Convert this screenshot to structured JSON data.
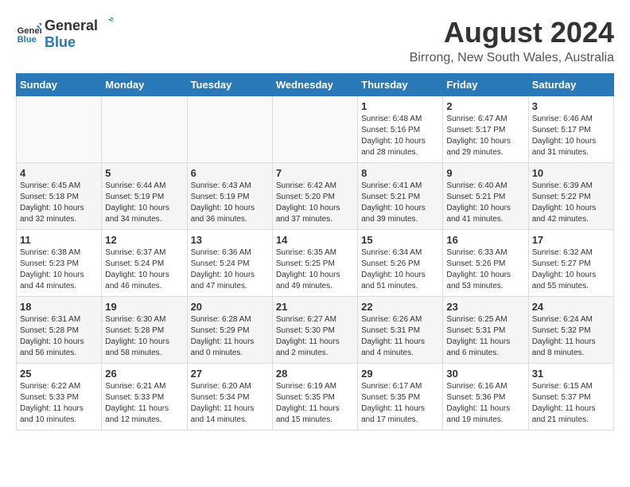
{
  "logo": {
    "line1": "General",
    "line2": "Blue"
  },
  "title": "August 2024",
  "location": "Birrong, New South Wales, Australia",
  "days_of_week": [
    "Sunday",
    "Monday",
    "Tuesday",
    "Wednesday",
    "Thursday",
    "Friday",
    "Saturday"
  ],
  "weeks": [
    [
      {
        "day": "",
        "info": ""
      },
      {
        "day": "",
        "info": ""
      },
      {
        "day": "",
        "info": ""
      },
      {
        "day": "",
        "info": ""
      },
      {
        "day": "1",
        "info": "Sunrise: 6:48 AM\nSunset: 5:16 PM\nDaylight: 10 hours\nand 28 minutes."
      },
      {
        "day": "2",
        "info": "Sunrise: 6:47 AM\nSunset: 5:17 PM\nDaylight: 10 hours\nand 29 minutes."
      },
      {
        "day": "3",
        "info": "Sunrise: 6:46 AM\nSunset: 5:17 PM\nDaylight: 10 hours\nand 31 minutes."
      }
    ],
    [
      {
        "day": "4",
        "info": "Sunrise: 6:45 AM\nSunset: 5:18 PM\nDaylight: 10 hours\nand 32 minutes."
      },
      {
        "day": "5",
        "info": "Sunrise: 6:44 AM\nSunset: 5:19 PM\nDaylight: 10 hours\nand 34 minutes."
      },
      {
        "day": "6",
        "info": "Sunrise: 6:43 AM\nSunset: 5:19 PM\nDaylight: 10 hours\nand 36 minutes."
      },
      {
        "day": "7",
        "info": "Sunrise: 6:42 AM\nSunset: 5:20 PM\nDaylight: 10 hours\nand 37 minutes."
      },
      {
        "day": "8",
        "info": "Sunrise: 6:41 AM\nSunset: 5:21 PM\nDaylight: 10 hours\nand 39 minutes."
      },
      {
        "day": "9",
        "info": "Sunrise: 6:40 AM\nSunset: 5:21 PM\nDaylight: 10 hours\nand 41 minutes."
      },
      {
        "day": "10",
        "info": "Sunrise: 6:39 AM\nSunset: 5:22 PM\nDaylight: 10 hours\nand 42 minutes."
      }
    ],
    [
      {
        "day": "11",
        "info": "Sunrise: 6:38 AM\nSunset: 5:23 PM\nDaylight: 10 hours\nand 44 minutes."
      },
      {
        "day": "12",
        "info": "Sunrise: 6:37 AM\nSunset: 5:24 PM\nDaylight: 10 hours\nand 46 minutes."
      },
      {
        "day": "13",
        "info": "Sunrise: 6:36 AM\nSunset: 5:24 PM\nDaylight: 10 hours\nand 47 minutes."
      },
      {
        "day": "14",
        "info": "Sunrise: 6:35 AM\nSunset: 5:25 PM\nDaylight: 10 hours\nand 49 minutes."
      },
      {
        "day": "15",
        "info": "Sunrise: 6:34 AM\nSunset: 5:26 PM\nDaylight: 10 hours\nand 51 minutes."
      },
      {
        "day": "16",
        "info": "Sunrise: 6:33 AM\nSunset: 5:26 PM\nDaylight: 10 hours\nand 53 minutes."
      },
      {
        "day": "17",
        "info": "Sunrise: 6:32 AM\nSunset: 5:27 PM\nDaylight: 10 hours\nand 55 minutes."
      }
    ],
    [
      {
        "day": "18",
        "info": "Sunrise: 6:31 AM\nSunset: 5:28 PM\nDaylight: 10 hours\nand 56 minutes."
      },
      {
        "day": "19",
        "info": "Sunrise: 6:30 AM\nSunset: 5:28 PM\nDaylight: 10 hours\nand 58 minutes."
      },
      {
        "day": "20",
        "info": "Sunrise: 6:28 AM\nSunset: 5:29 PM\nDaylight: 11 hours\nand 0 minutes."
      },
      {
        "day": "21",
        "info": "Sunrise: 6:27 AM\nSunset: 5:30 PM\nDaylight: 11 hours\nand 2 minutes."
      },
      {
        "day": "22",
        "info": "Sunrise: 6:26 AM\nSunset: 5:31 PM\nDaylight: 11 hours\nand 4 minutes."
      },
      {
        "day": "23",
        "info": "Sunrise: 6:25 AM\nSunset: 5:31 PM\nDaylight: 11 hours\nand 6 minutes."
      },
      {
        "day": "24",
        "info": "Sunrise: 6:24 AM\nSunset: 5:32 PM\nDaylight: 11 hours\nand 8 minutes."
      }
    ],
    [
      {
        "day": "25",
        "info": "Sunrise: 6:22 AM\nSunset: 5:33 PM\nDaylight: 11 hours\nand 10 minutes."
      },
      {
        "day": "26",
        "info": "Sunrise: 6:21 AM\nSunset: 5:33 PM\nDaylight: 11 hours\nand 12 minutes."
      },
      {
        "day": "27",
        "info": "Sunrise: 6:20 AM\nSunset: 5:34 PM\nDaylight: 11 hours\nand 14 minutes."
      },
      {
        "day": "28",
        "info": "Sunrise: 6:19 AM\nSunset: 5:35 PM\nDaylight: 11 hours\nand 15 minutes."
      },
      {
        "day": "29",
        "info": "Sunrise: 6:17 AM\nSunset: 5:35 PM\nDaylight: 11 hours\nand 17 minutes."
      },
      {
        "day": "30",
        "info": "Sunrise: 6:16 AM\nSunset: 5:36 PM\nDaylight: 11 hours\nand 19 minutes."
      },
      {
        "day": "31",
        "info": "Sunrise: 6:15 AM\nSunset: 5:37 PM\nDaylight: 11 hours\nand 21 minutes."
      }
    ]
  ]
}
